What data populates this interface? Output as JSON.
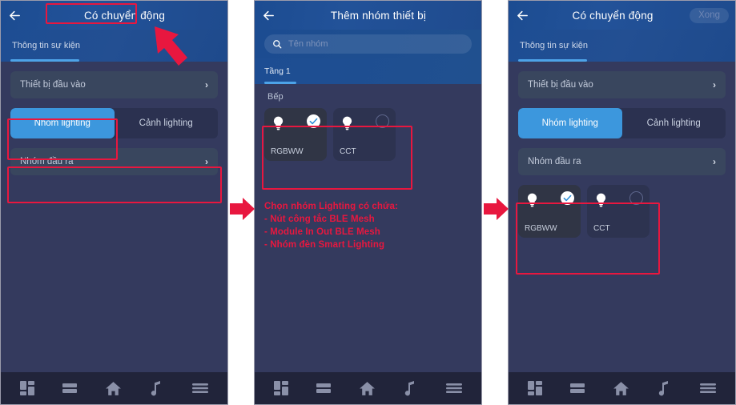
{
  "panels": [
    {
      "id": "panel-left",
      "header": {
        "title": "Có chuyển động",
        "back_icon": "arrow-left-icon"
      },
      "tab": {
        "label": "Thông tin sự kiện"
      },
      "rows": [
        {
          "label": "Thiết bị đầu vào",
          "chevron": "›"
        },
        {
          "label": "Nhóm đầu ra",
          "chevron": "›"
        }
      ],
      "segments": [
        {
          "label": "Nhóm lighting",
          "active": true
        },
        {
          "label": "Cảnh lighting",
          "active": false
        }
      ]
    },
    {
      "id": "panel-middle",
      "header": {
        "title": "Thêm nhóm thiết bị",
        "back_icon": "arrow-left-icon"
      },
      "search": {
        "placeholder": "Tên nhóm",
        "icon": "search-icon"
      },
      "floor": {
        "label": "Tầng 1"
      },
      "group_label": "Bếp",
      "devices": [
        {
          "name": "RGBWW",
          "icon": "lightbulb-icon",
          "selected": true
        },
        {
          "name": "CCT",
          "icon": "lightbulb-icon",
          "selected": false
        }
      ]
    },
    {
      "id": "panel-right",
      "header": {
        "title": "Có chuyển động",
        "back_icon": "arrow-left-icon",
        "action_label": "Xong"
      },
      "tab": {
        "label": "Thông tin sự kiện"
      },
      "rows": [
        {
          "label": "Thiết bị đầu vào",
          "chevron": "›"
        },
        {
          "label": "Nhóm đầu ra",
          "chevron": "›"
        }
      ],
      "segments": [
        {
          "label": "Nhóm lighting",
          "active": true
        },
        {
          "label": "Cảnh lighting",
          "active": false
        }
      ],
      "devices": [
        {
          "name": "RGBWW",
          "icon": "lightbulb-icon",
          "selected": true
        },
        {
          "name": "CCT",
          "icon": "lightbulb-icon",
          "selected": false
        }
      ]
    }
  ],
  "bottom_nav": [
    {
      "icon": "dashboard-grid-icon"
    },
    {
      "icon": "rows-list-icon"
    },
    {
      "icon": "home-icon"
    },
    {
      "icon": "music-note-icon"
    },
    {
      "icon": "hamburger-menu-icon"
    }
  ],
  "annotation": {
    "lines": [
      "Chọn nhóm Lighting có chứa:",
      "- Nút công tắc BLE Mesh",
      "- Module In Out BLE Mesh",
      "- Nhóm đèn Smart Lighting"
    ],
    "color": "#e8173f"
  }
}
